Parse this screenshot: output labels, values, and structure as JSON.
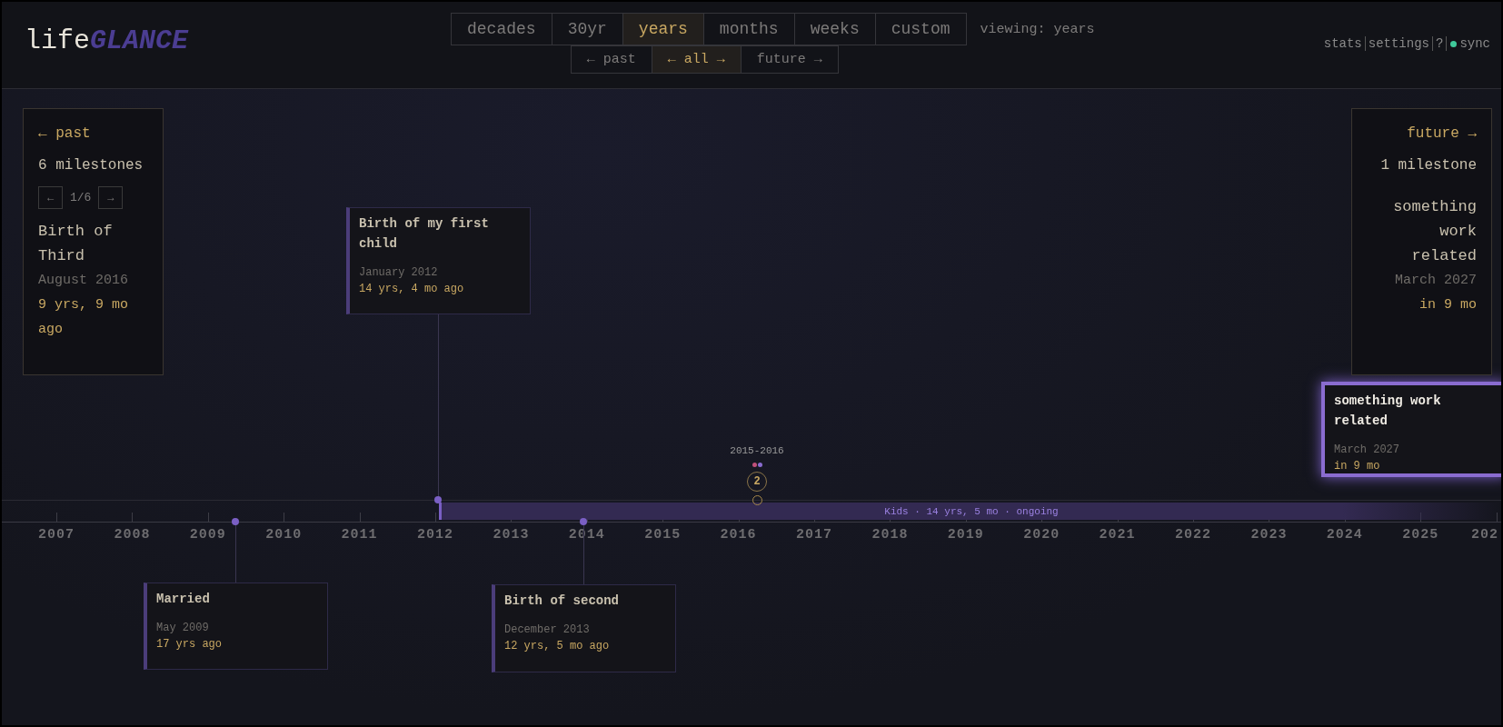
{
  "header": {
    "logo": {
      "prefix": "life",
      "accent": "GLANCE"
    },
    "zoom_tabs": [
      {
        "label": "decades",
        "selected": false
      },
      {
        "label": "30yr",
        "selected": false
      },
      {
        "label": "years",
        "selected": true
      },
      {
        "label": "months",
        "selected": false
      },
      {
        "label": "weeks",
        "selected": false
      },
      {
        "label": "custom",
        "selected": false
      }
    ],
    "viewing": "viewing: years",
    "direction_tabs": [
      {
        "label": "← past",
        "selected": false
      },
      {
        "label": "← all →",
        "selected": true
      },
      {
        "label": "future →",
        "selected": false
      }
    ],
    "links": [
      "stats",
      "settings",
      "?"
    ],
    "sync": {
      "label": "sync",
      "on": true
    }
  },
  "past_panel": {
    "heading": "← past",
    "count": "6 milestones",
    "pager": {
      "prev": "←",
      "page": "1/6",
      "next": "→"
    },
    "title": "Birth of Third",
    "date": "August 2016",
    "relative": "9 yrs, 9 mo ago"
  },
  "future_panel": {
    "heading": "future →",
    "count": "1 milestone",
    "title": "something work related",
    "date": "March 2027",
    "relative": "in 9 mo"
  },
  "timeline": {
    "years": [
      "2007",
      "2008",
      "2009",
      "2010",
      "2011",
      "2012",
      "2013",
      "2014",
      "2015",
      "2016",
      "2017",
      "2018",
      "2019",
      "2020",
      "2021",
      "2022",
      "2023",
      "2024",
      "2025",
      "202"
    ],
    "range_bars": [
      {
        "label": "Kids · 14 yrs, 5 mo · ongoing"
      }
    ],
    "cluster": {
      "label": "2015-2016",
      "count": "2",
      "dots": [
        {
          "color": "#c0507a"
        },
        {
          "color": "#8a6cd0"
        }
      ]
    },
    "milestones": [
      {
        "title": "Married",
        "date": "May 2009",
        "relative": "17 yrs ago",
        "highlighted": false
      },
      {
        "title": "Birth of my first child",
        "date": "January 2012",
        "relative": "14 yrs, 4 mo ago",
        "highlighted": false
      },
      {
        "title": "Birth of second",
        "date": "December 2013",
        "relative": "12 yrs, 5 mo ago",
        "highlighted": false
      },
      {
        "title": "something work related",
        "date": "March 2027",
        "relative": "in 9 mo",
        "highlighted": true
      }
    ]
  }
}
